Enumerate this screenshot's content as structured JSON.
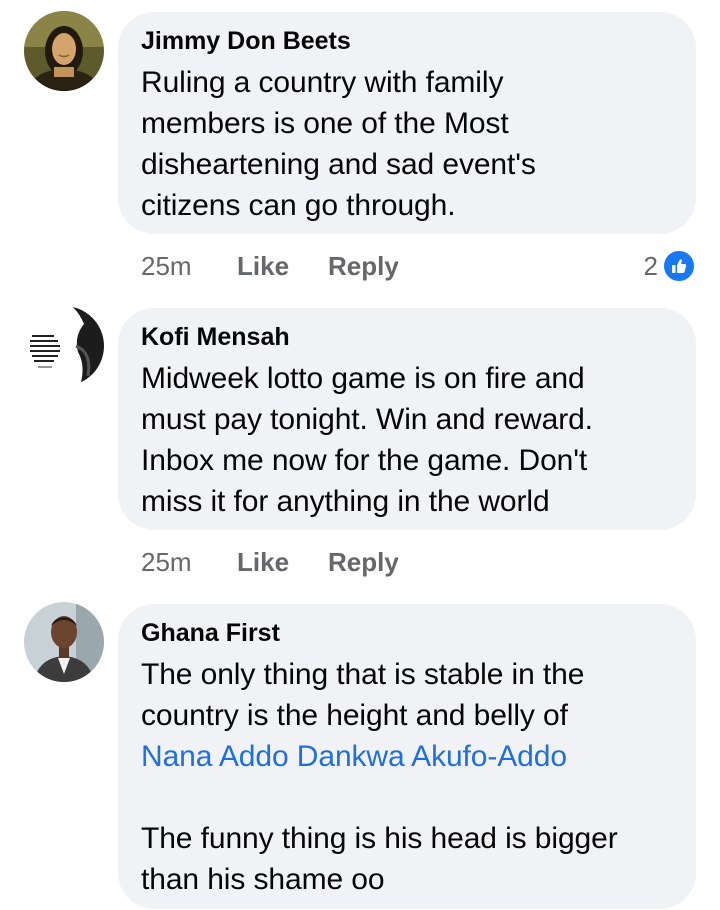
{
  "comments": [
    {
      "author": "Jimmy Don Beets",
      "avatar_icon": "mona-lisa-avatar",
      "lines": [
        "Ruling a country with family",
        "members is one of the Most",
        "disheartening and sad event's",
        "citizens can go through."
      ],
      "time": "25m",
      "like_label": "Like",
      "reply_label": "Reply",
      "reaction_count": "2",
      "reaction_icon": "thumbs-up-icon"
    },
    {
      "author": "Kofi Mensah",
      "avatar_icon": "quote-poster-avatar",
      "lines": [
        "Midweek lotto game is on fire and",
        "must pay tonight. Win and reward.",
        "Inbox me now for the game. Don't",
        "miss it for anything in the world"
      ],
      "time": "25m",
      "like_label": "Like",
      "reply_label": "Reply"
    },
    {
      "author": "Ghana First",
      "avatar_icon": "man-portrait-avatar",
      "lines": [
        "The only thing that is stable  in the",
        "country is the height and belly of"
      ],
      "mention": "Nana Addo Dankwa Akufo-Addo",
      "lines_after": [
        "The funny thing is his head is bigger",
        "than his shame oo"
      ]
    }
  ],
  "colors": {
    "bubble": "#f0f2f5",
    "link": "#216fdb",
    "secondary_text": "#65676b",
    "like_badge": "#1877f2"
  }
}
